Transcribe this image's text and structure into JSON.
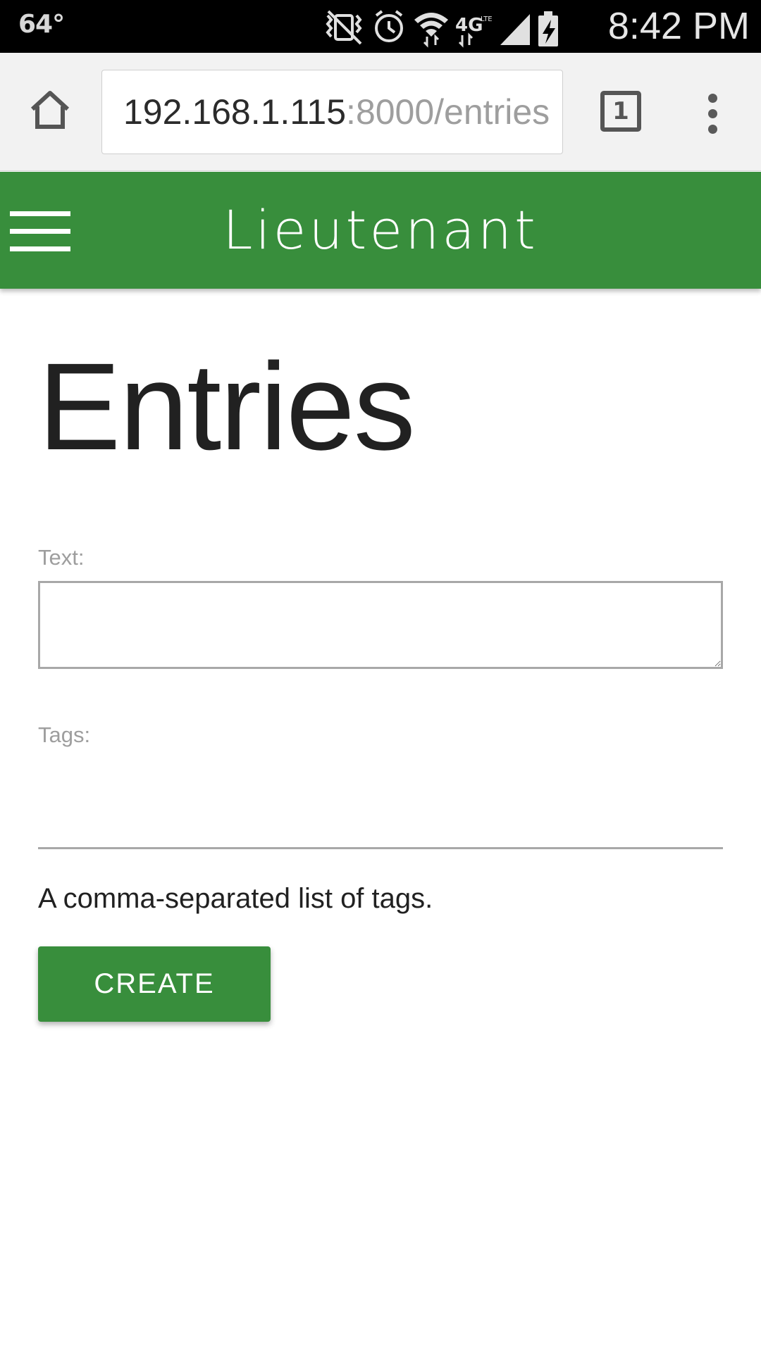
{
  "status_bar": {
    "temperature": "64°",
    "time": "8:42 PM",
    "icons": [
      "mute-vibrate-icon",
      "alarm-icon",
      "wifi-icon",
      "4g-lte-icon",
      "signal-icon",
      "battery-charging-icon"
    ]
  },
  "browser": {
    "url_host": "192.168.1.115",
    "url_rest": ":8000/entries",
    "tab_count": "1"
  },
  "app_bar": {
    "title": "Lieutenant"
  },
  "page": {
    "title": "Entries",
    "text_label": "Text:",
    "text_value": "",
    "tags_label": "Tags:",
    "tags_value": "",
    "tags_help": "A comma-separated list of tags.",
    "create_label": "CREATE"
  },
  "colors": {
    "primary": "#388e3c",
    "status_bar_bg": "#000000",
    "browser_bar_bg": "#f2f2f2"
  }
}
